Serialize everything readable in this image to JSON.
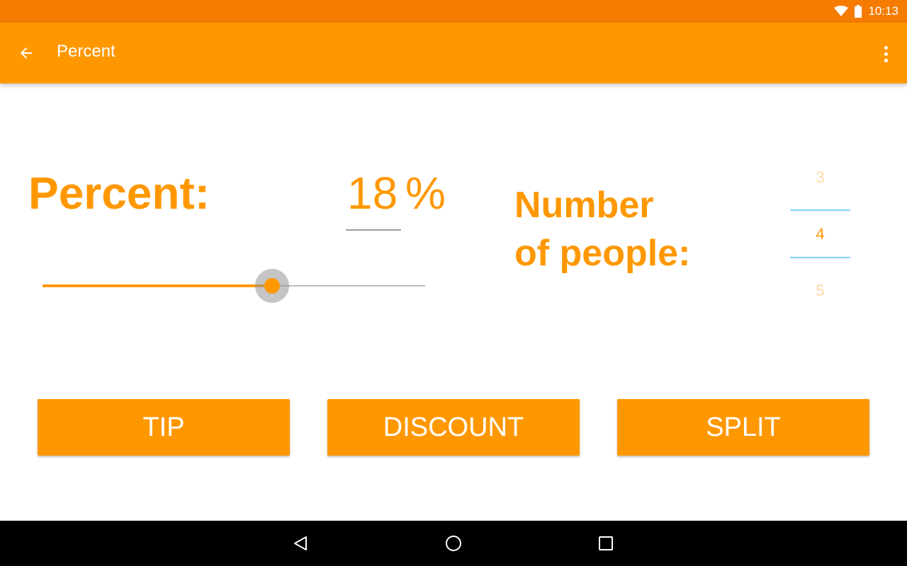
{
  "status_bar": {
    "time": "10:13",
    "wifi_icon": "wifi-icon",
    "battery_icon": "battery-icon"
  },
  "app_bar": {
    "title": "Percent",
    "back_icon": "arrow-back-icon",
    "menu_icon": "overflow-menu-icon",
    "color": "#FF9800"
  },
  "percent": {
    "label": "Percent:",
    "value": "18",
    "sign": "%",
    "slider_fraction": 0.6
  },
  "people": {
    "label_line1": "Number",
    "label_line2": "of people:",
    "options": [
      "3",
      "4",
      "5"
    ],
    "selected": "4"
  },
  "buttons": {
    "tip": "TIP",
    "discount": "DISCOUNT",
    "split": "SPLIT"
  },
  "nav_bar": {
    "back_icon": "nav-back-icon",
    "home_icon": "nav-home-icon",
    "recents_icon": "nav-recents-icon"
  },
  "colors": {
    "accent": "#FF9800",
    "status_bar": "#F57C00",
    "picker_divider": "#81D4FA"
  }
}
